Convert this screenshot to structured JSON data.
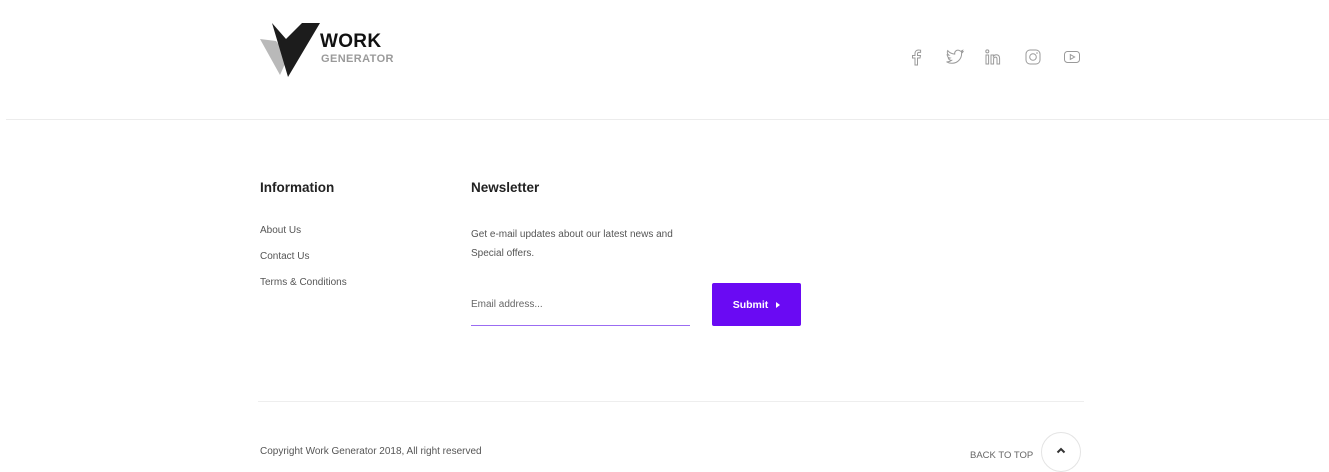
{
  "brand": {
    "name_line1": "WORK",
    "name_line2": "GENERATOR"
  },
  "social": [
    {
      "icon": "facebook-icon"
    },
    {
      "icon": "twitter-icon"
    },
    {
      "icon": "linkedin-icon"
    },
    {
      "icon": "instagram-icon"
    },
    {
      "icon": "youtube-icon"
    }
  ],
  "information": {
    "title": "Information",
    "links": [
      "About Us",
      "Contact Us",
      "Terms & Conditions"
    ]
  },
  "newsletter": {
    "title": "Newsletter",
    "text": "Get e-mail updates about our latest news and Special offers.",
    "email_placeholder": "Email address...",
    "submit_label": "Submit"
  },
  "footer": {
    "copyright": "Copyright Work Generator 2018, All right reserved",
    "back_to_top_label": "BACK TO TOP"
  },
  "colors": {
    "accent": "#6a0af3",
    "input_underline": "#9b6cf2",
    "icon_gray": "#9a9a9a"
  }
}
